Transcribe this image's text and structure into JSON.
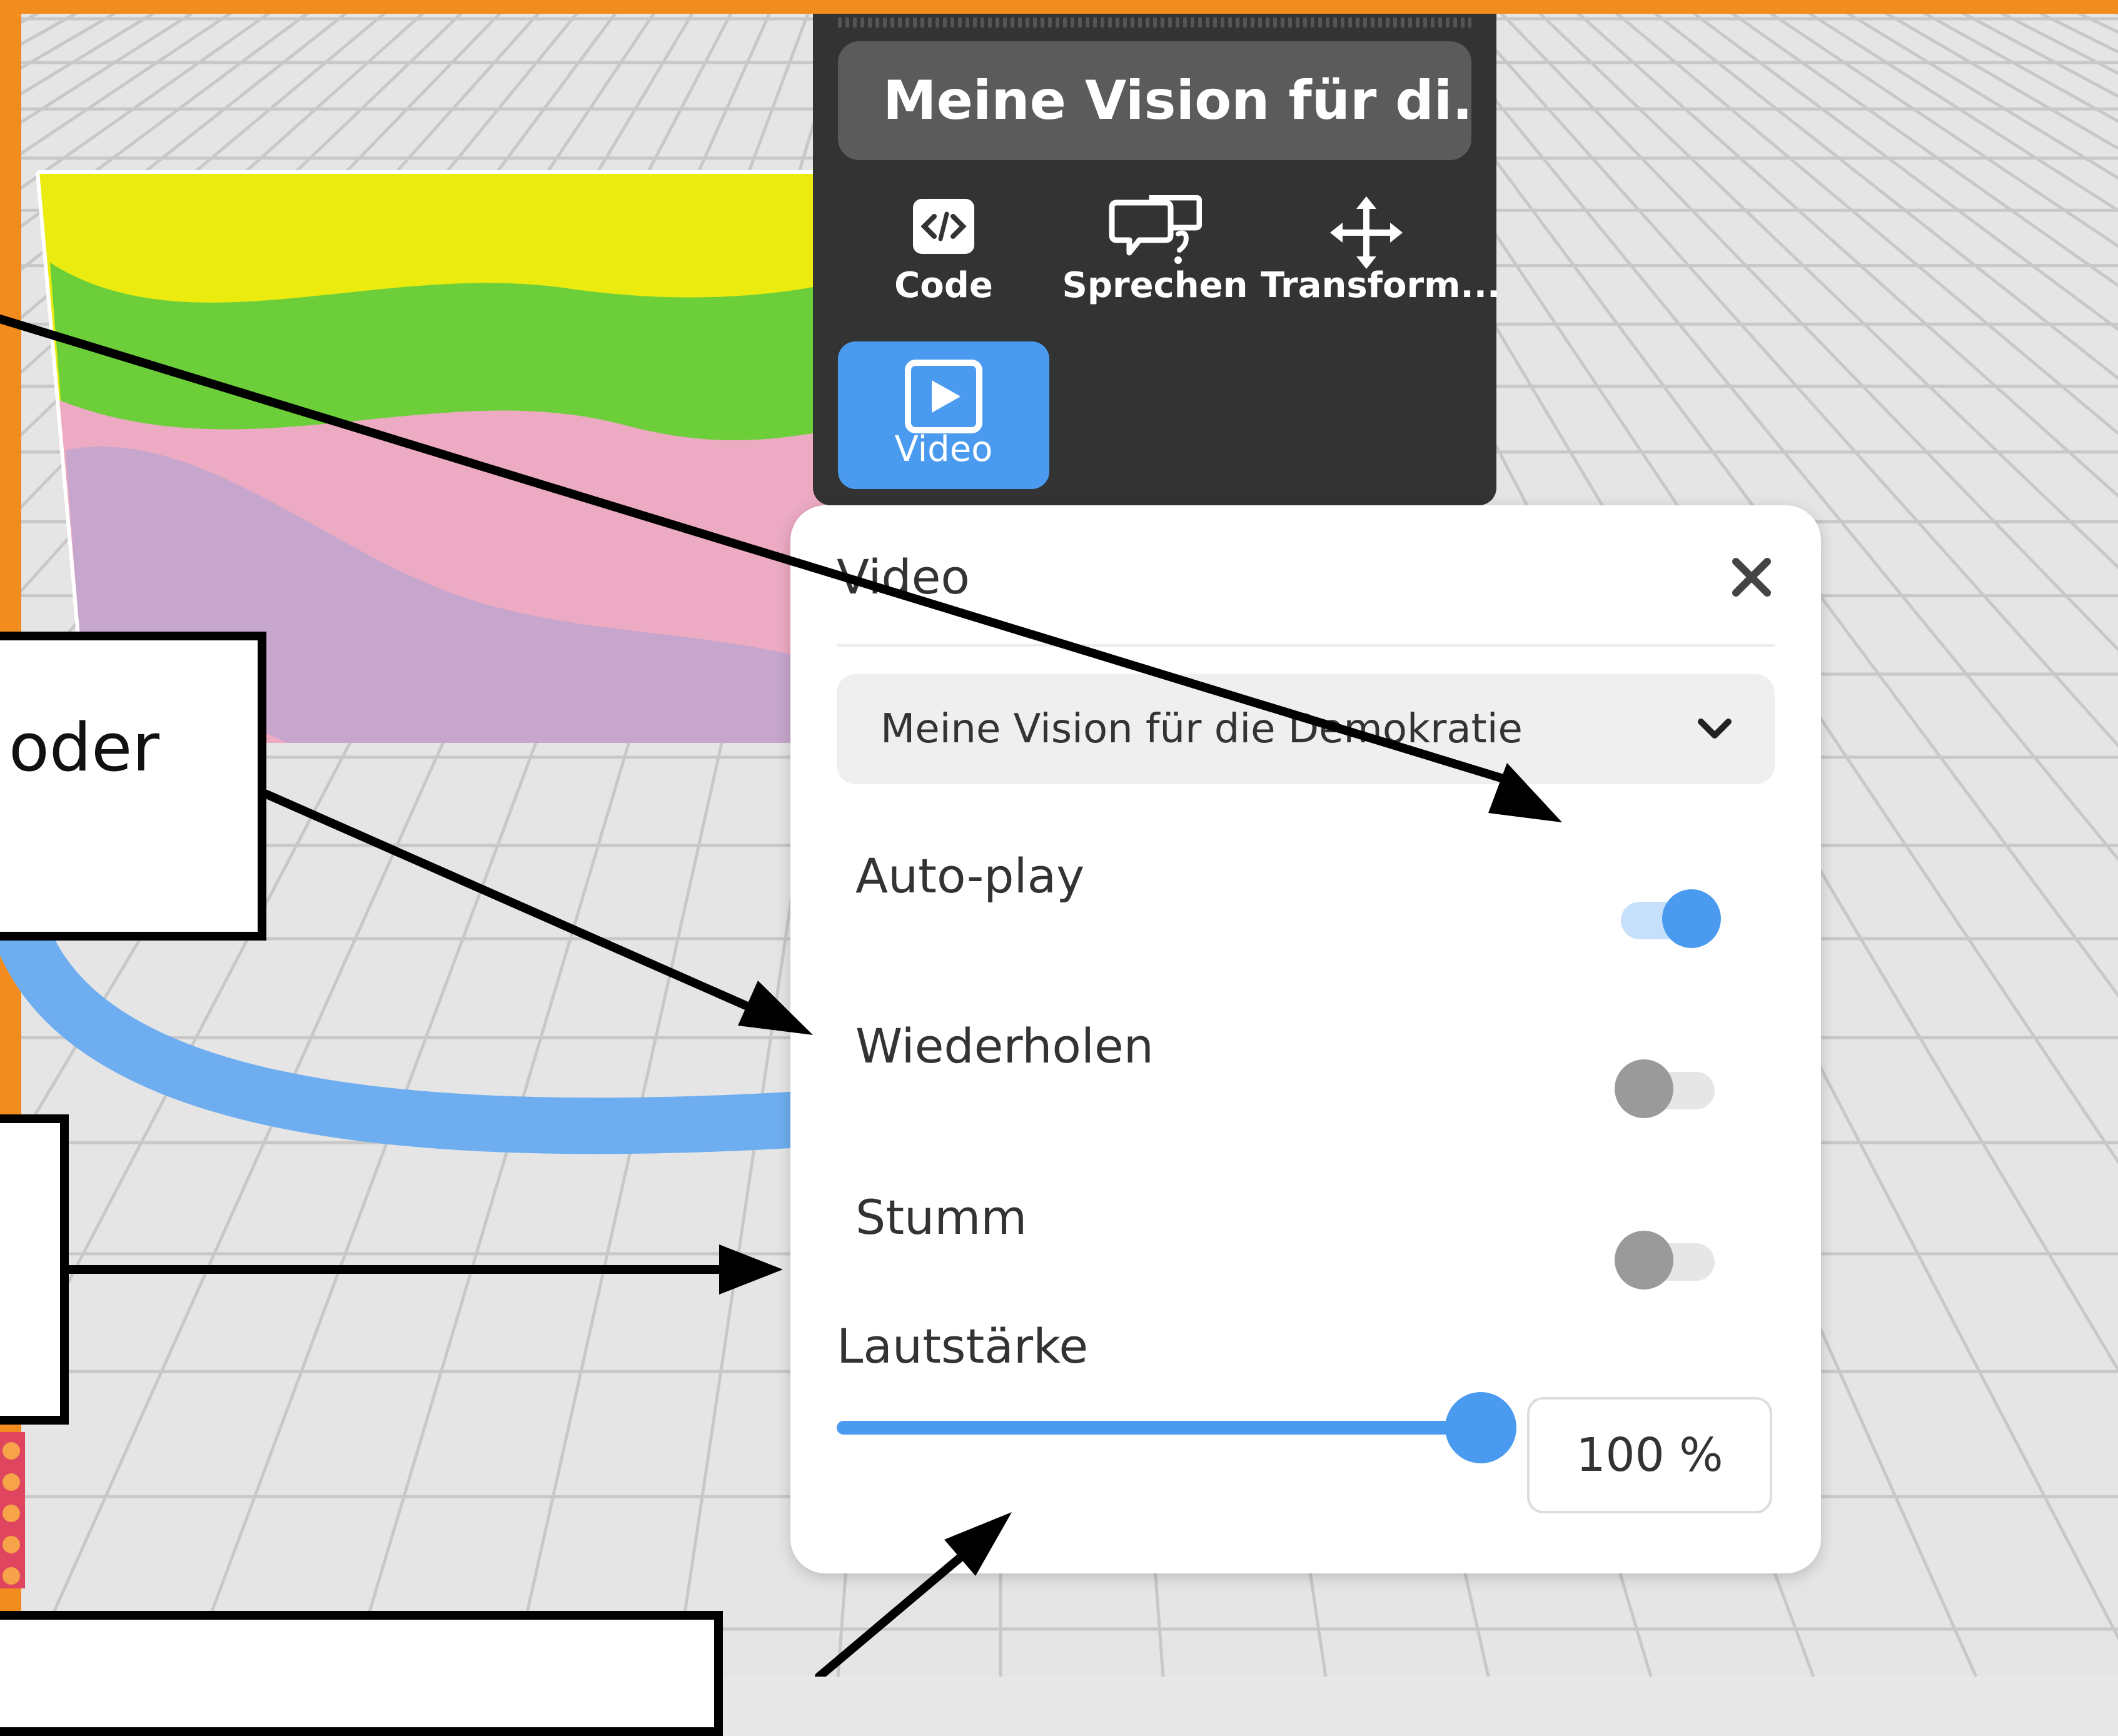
{
  "toolbar": {
    "title": "Meine Vision für di...",
    "tools": [
      {
        "label": "Code",
        "icon": "code-icon"
      },
      {
        "label": "Sprechen",
        "icon": "speech-bubble-icon"
      },
      {
        "label": "Transform...",
        "icon": "move-arrows-icon"
      },
      {
        "label": "Video",
        "icon": "play-video-icon",
        "active": true
      }
    ]
  },
  "panel": {
    "title": "Video",
    "close_icon": "close-icon",
    "video_select": {
      "value": "Meine Vision für die Demokratie",
      "icon": "chevron-down-icon"
    },
    "toggles": [
      {
        "label": "Auto-play",
        "on": true
      },
      {
        "label": "Wiederholen",
        "on": false
      },
      {
        "label": "Stumm",
        "on": false
      }
    ],
    "volume": {
      "label": "Lautstärke",
      "percent": 100,
      "display": "100 %"
    }
  },
  "callouts": [
    {
      "text": "oder"
    }
  ],
  "colors": {
    "accent": "#4a9bf0",
    "frame_orange": "#f28c1e",
    "toolbar_bg": "#333333",
    "toggle_off_knob": "#9a9a9a",
    "toggle_off_track": "#e6e6e6",
    "toggle_on_track": "#c6e0fb"
  }
}
